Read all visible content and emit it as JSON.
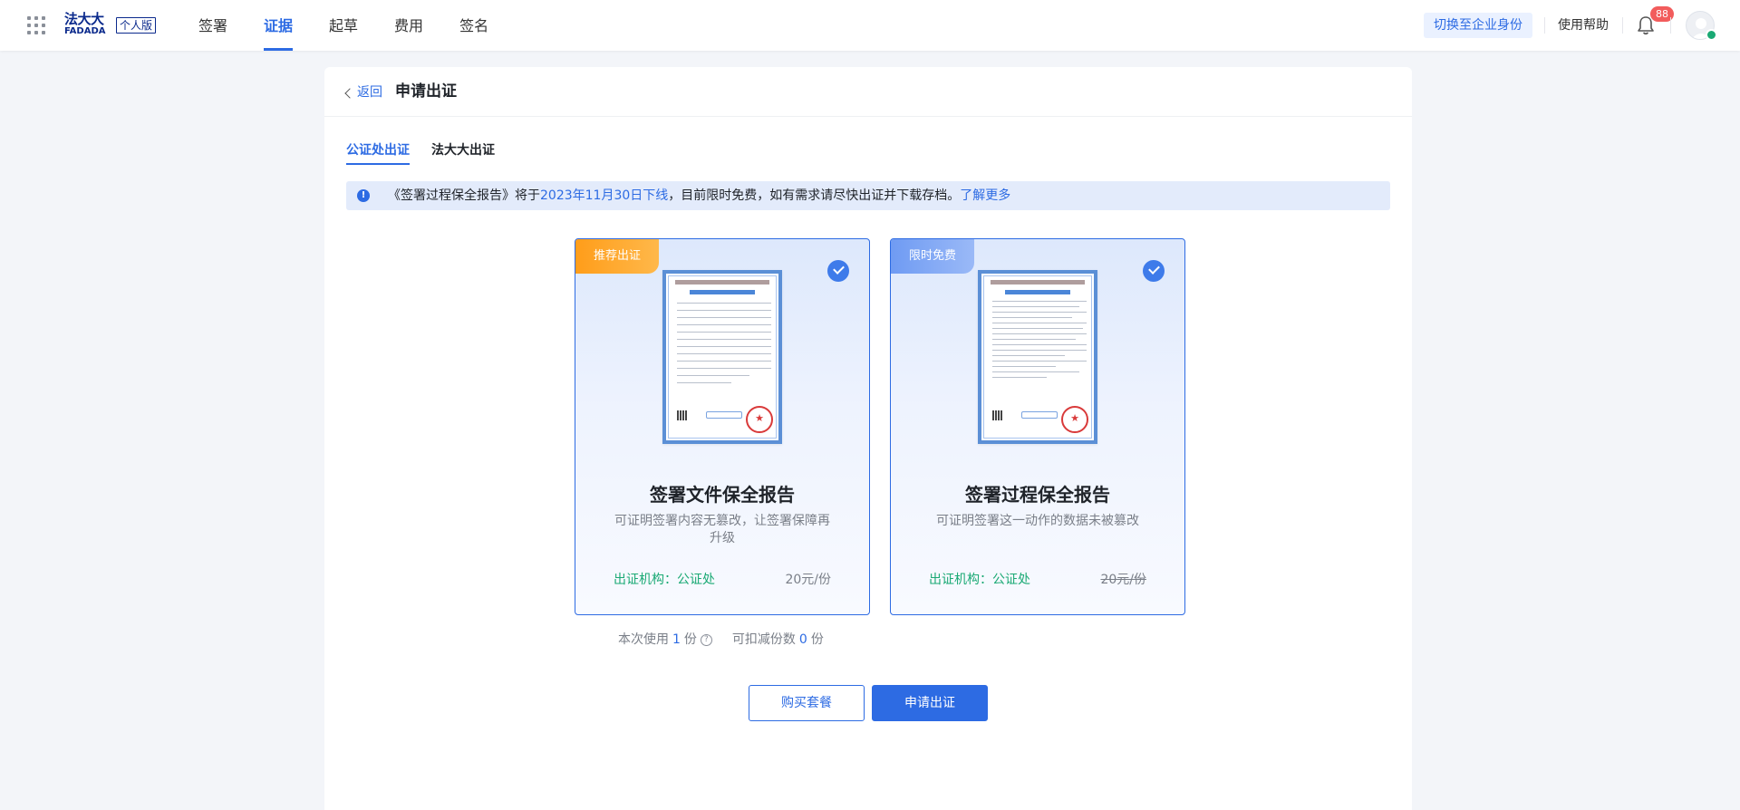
{
  "topbar": {
    "logo_cn": "法大大",
    "logo_en": "FADADA",
    "edition": "个人版",
    "nav": [
      "签署",
      "证据",
      "起草",
      "费用",
      "签名"
    ],
    "active_nav": "证据",
    "switch_identity": "切换至企业身份",
    "help": "使用帮助",
    "notification_count": "88"
  },
  "page": {
    "back": "返回",
    "title": "申请出证"
  },
  "tabs": [
    {
      "label": "公证处出证",
      "active": true
    },
    {
      "label": "法大大出证",
      "active": false
    }
  ],
  "notice": {
    "text_before": "《签署过程保全报告》将于",
    "highlight": "2023年11月30日下线",
    "text_after": "，目前限时免费，如有需求请尽快出证并下载存档。",
    "link": "了解更多"
  },
  "options": [
    {
      "ribbon": "推荐出证",
      "title": "签署文件保全报告",
      "desc": "可证明签署内容无篡改，让签署保障再升级",
      "org": "出证机构：公证处",
      "price": "20元/份",
      "selected": true
    },
    {
      "ribbon": "限时免费",
      "title": "签署过程保全报告",
      "desc": "可证明签署这一动作的数据未被篡改",
      "org": "出证机构：公证处",
      "price": "20元/份",
      "price_struck": true,
      "selected": true
    }
  ],
  "usage": {
    "use_label": "本次使用",
    "use_count": "1",
    "unit": "份",
    "deduct_label": "可扣减份数",
    "deduct_count": "0"
  },
  "actions": {
    "buy": "购买套餐",
    "apply": "申请出证"
  },
  "colors": {
    "primary": "#2d6be3",
    "success": "#1aa974",
    "ribbon_orange": "#ff9d1a",
    "badge_red": "#f25c5c"
  }
}
